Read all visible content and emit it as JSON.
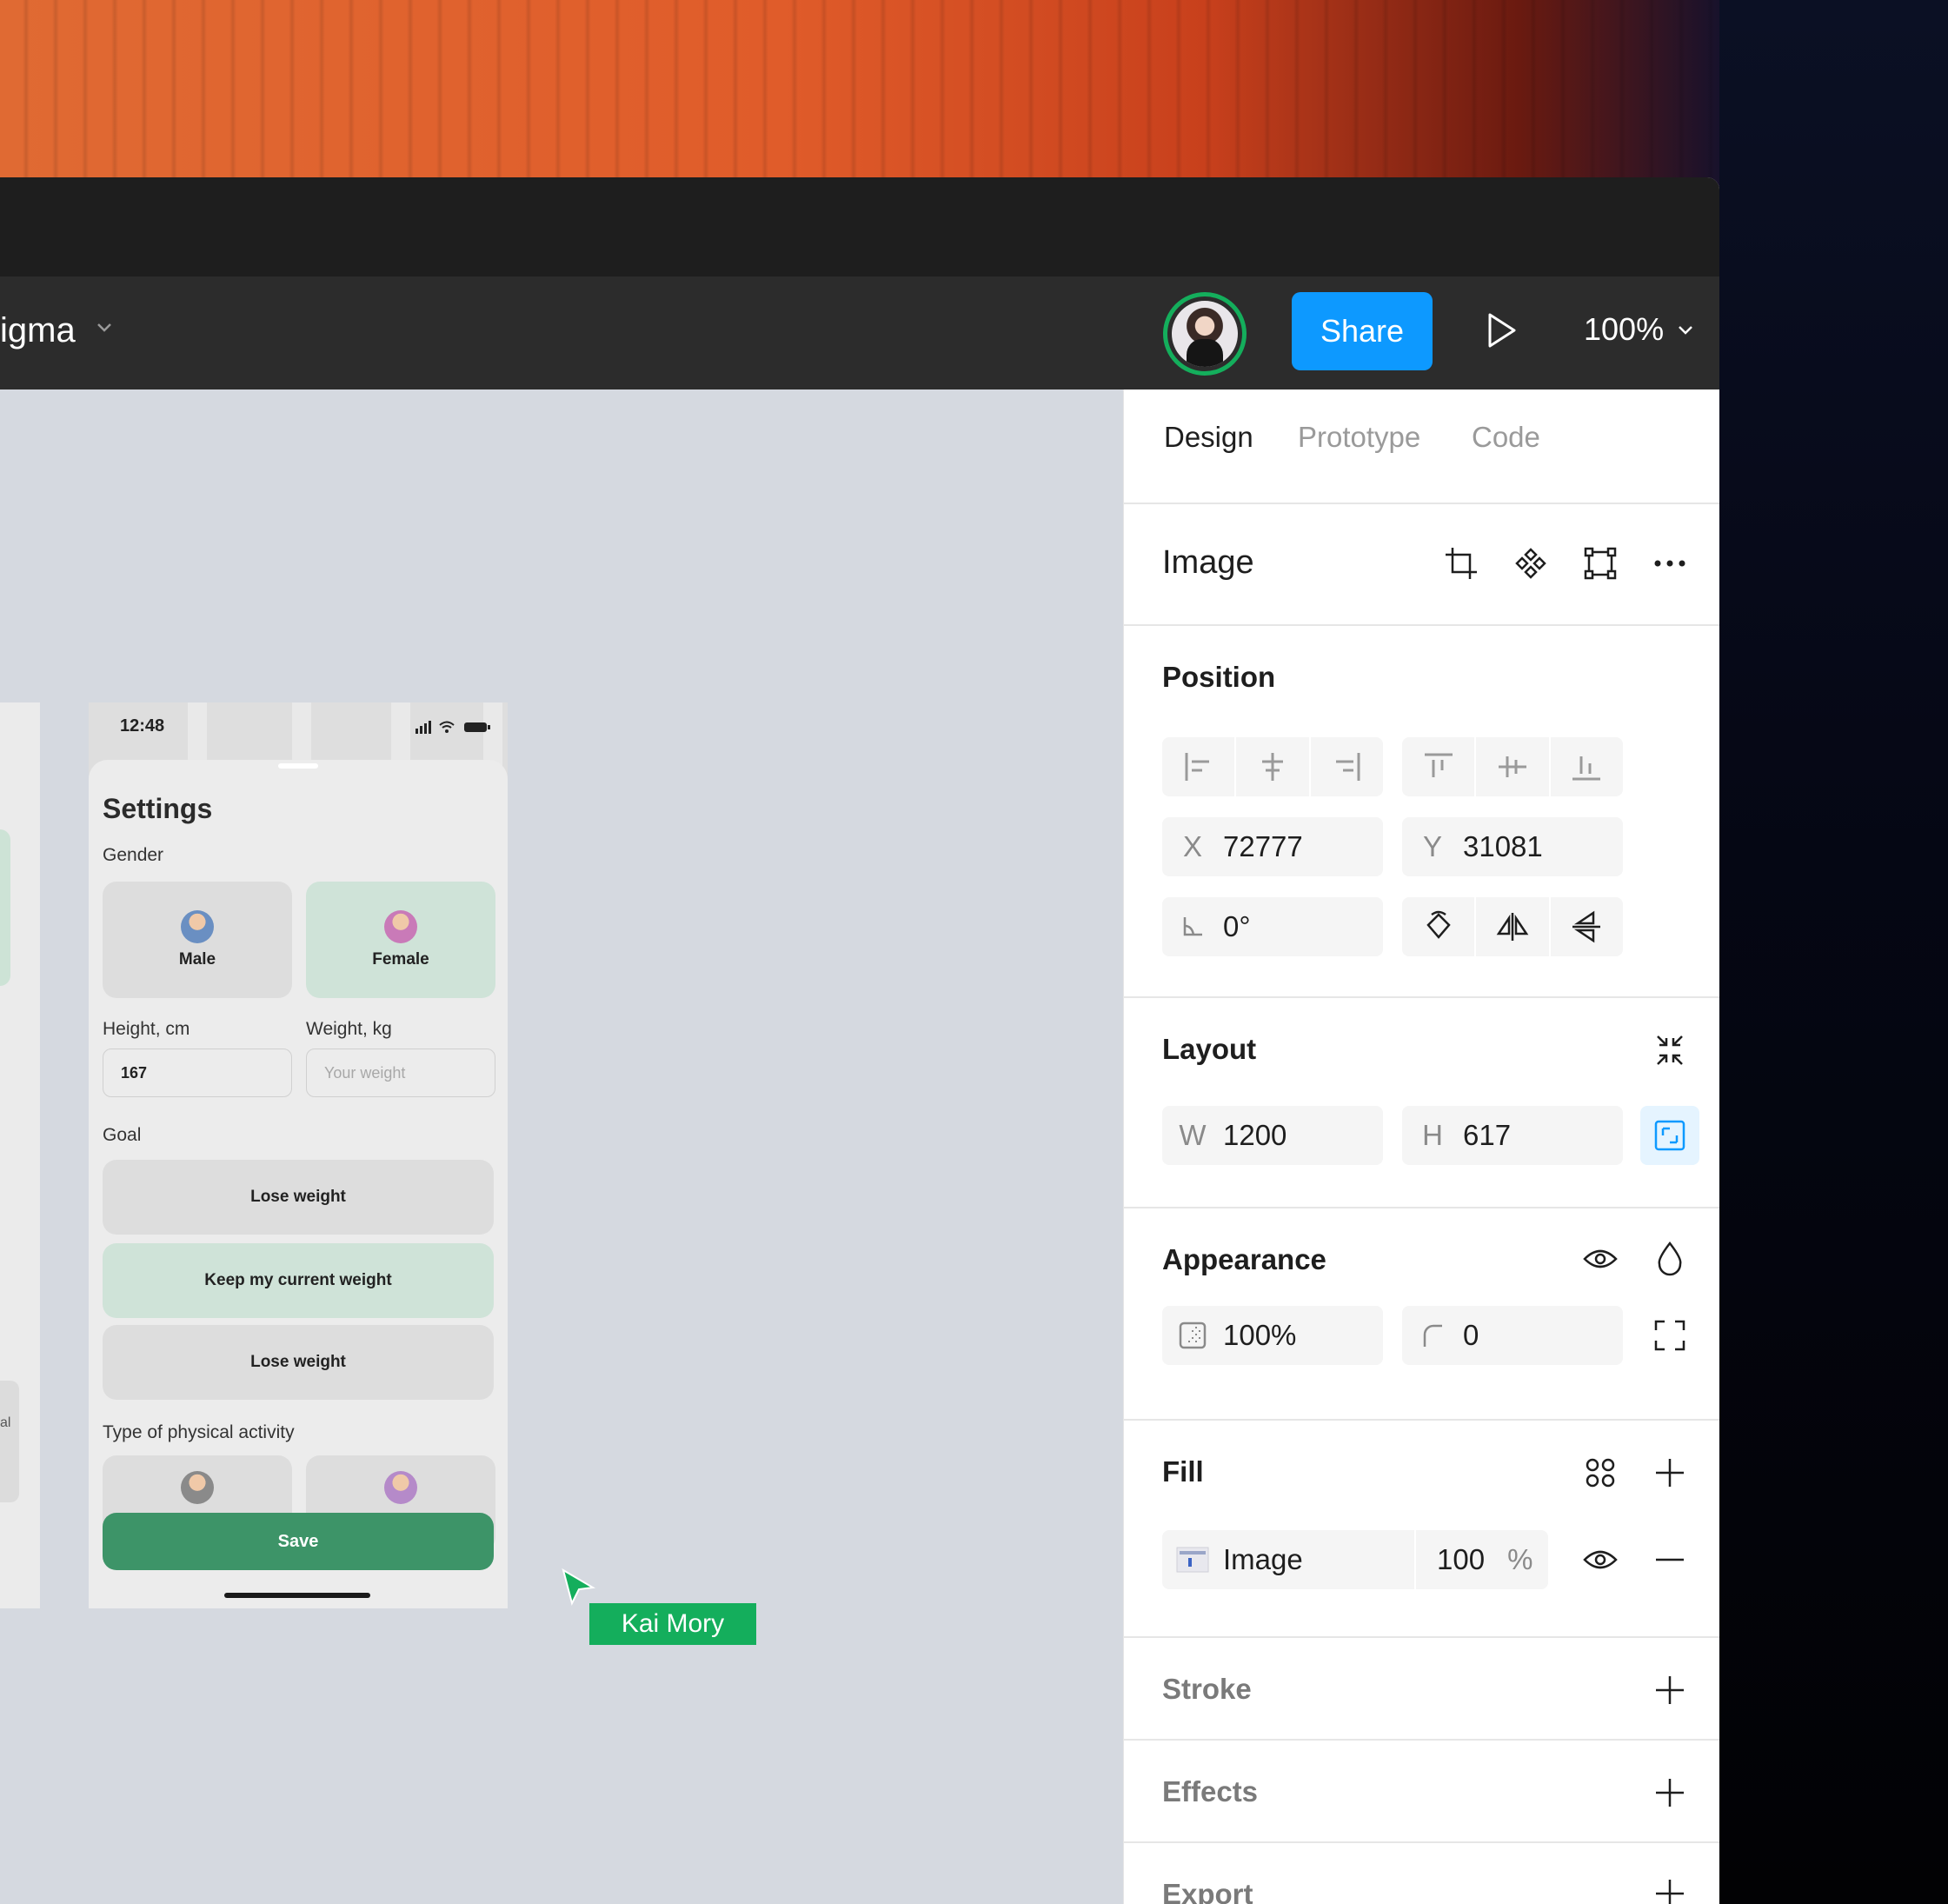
{
  "toolbar": {
    "file_name": "igma",
    "share_label": "Share",
    "zoom_label": "100%"
  },
  "phone": {
    "status_time": "12:48",
    "title": "Settings",
    "gender_label": "Gender",
    "male_label": "Male",
    "female_label": "Female",
    "height_label": "Height, cm",
    "weight_label": "Weight, kg",
    "height_value": "167",
    "weight_placeholder": "Your weight",
    "goal_label": "Goal",
    "goal_options": [
      "Lose weight",
      "Keep my current weight",
      "Lose weight"
    ],
    "activity_label": "Type of physical activity",
    "save_label": "Save",
    "left_frame_text": "al"
  },
  "cursor": {
    "name": "Kai Mory",
    "color": "#14ae5c"
  },
  "panel": {
    "tabs": {
      "design": "Design",
      "prototype": "Prototype",
      "code": "Code"
    },
    "image_title": "Image",
    "position": {
      "title": "Position",
      "x_label": "X",
      "x_value": "72777",
      "y_label": "Y",
      "y_value": "31081",
      "rotation_value": "0°"
    },
    "layout": {
      "title": "Layout",
      "w_label": "W",
      "w_value": "1200",
      "h_label": "H",
      "h_value": "617"
    },
    "appearance": {
      "title": "Appearance",
      "opacity_value": "100%",
      "radius_value": "0"
    },
    "fill": {
      "title": "Fill",
      "type_label": "Image",
      "opacity_value": "100",
      "percent_label": "%"
    },
    "stroke_title": "Stroke",
    "effects_title": "Effects",
    "export_title": "Export"
  },
  "colors": {
    "accent": "#0d99ff",
    "presence": "#14ae5c",
    "save_green": "#3d9468",
    "selected_card": "#cfe3d8"
  }
}
